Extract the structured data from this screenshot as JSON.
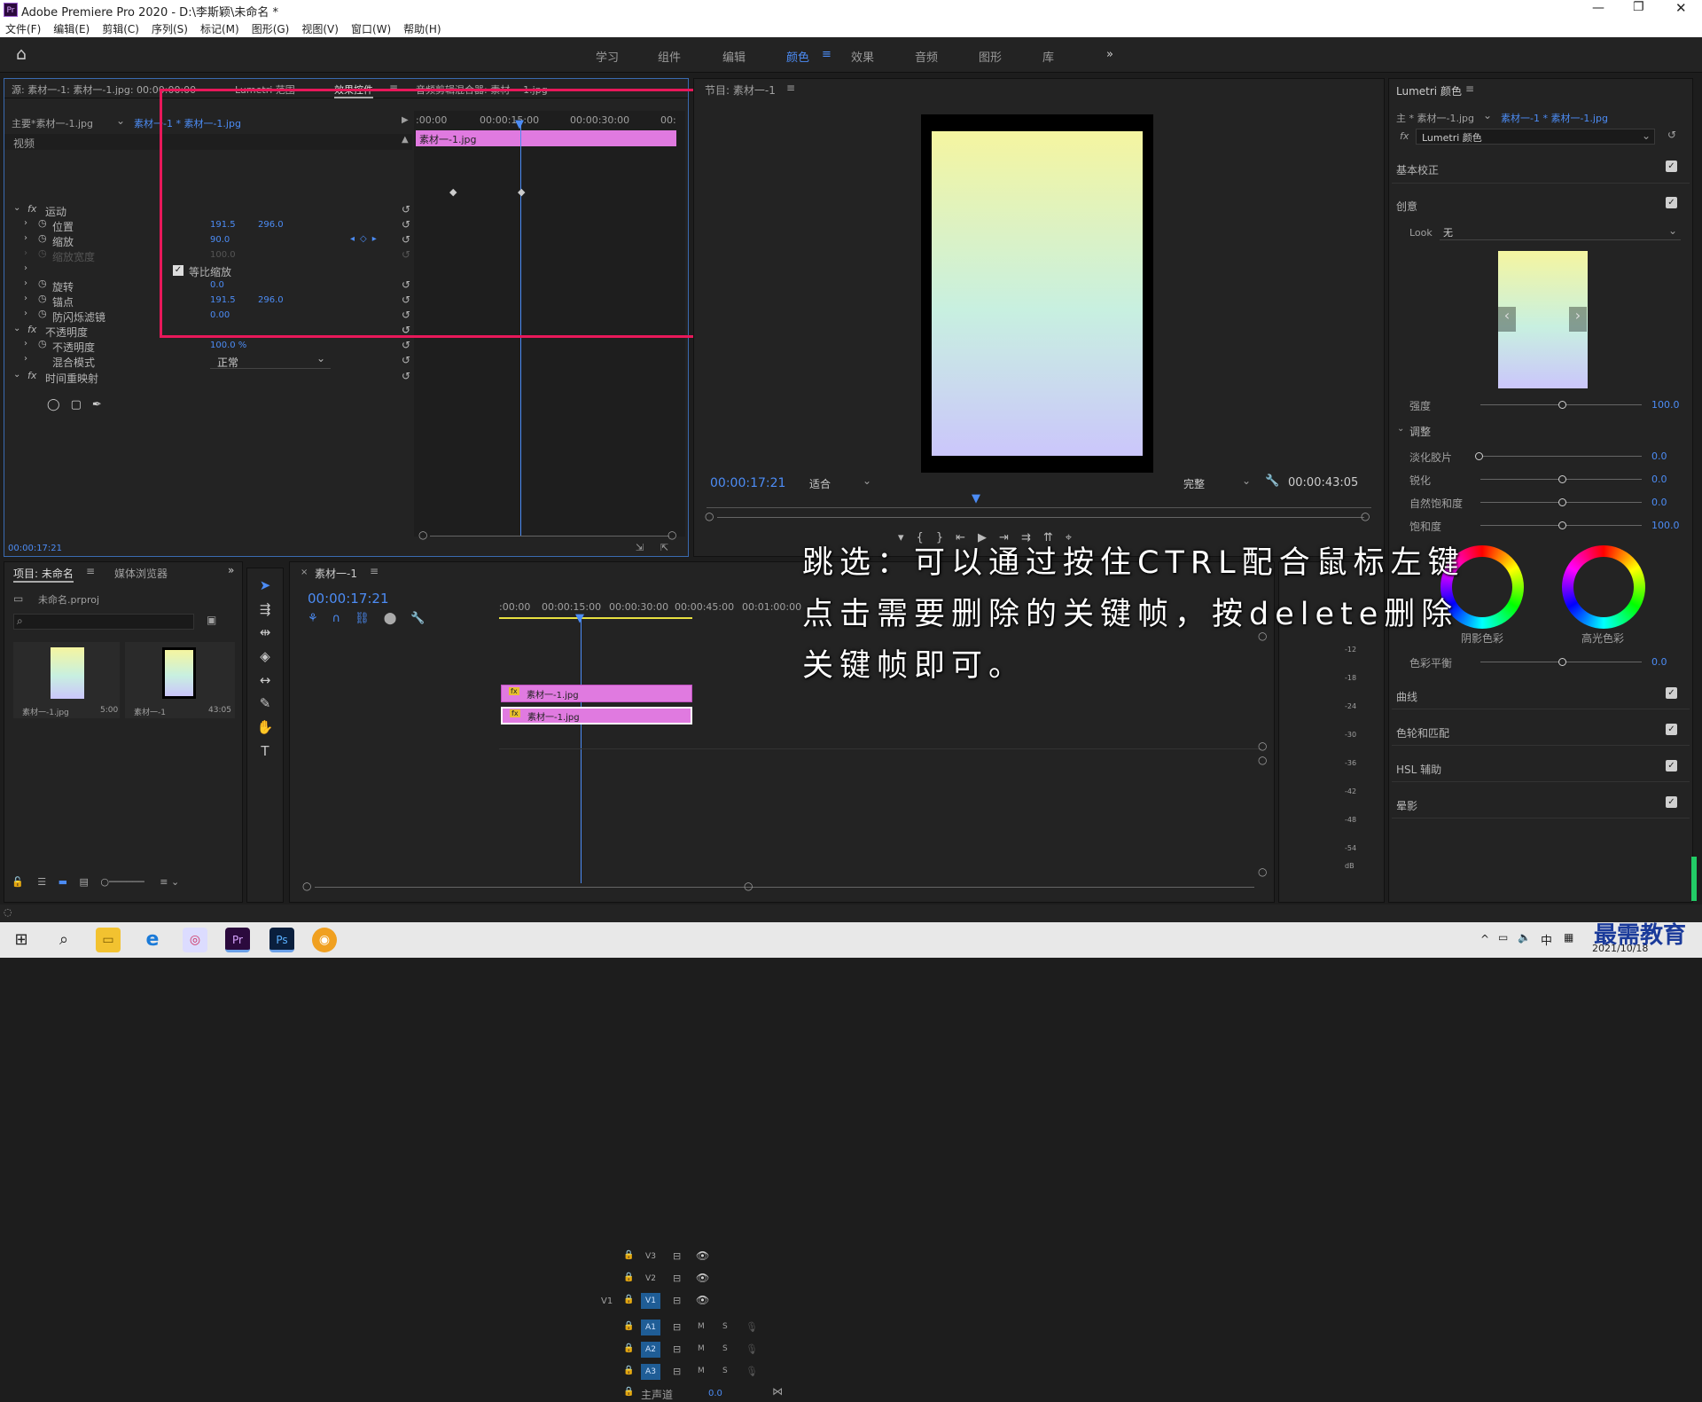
{
  "window": {
    "title": "Adobe Premiere Pro 2020 - D:\\李斯颖\\未命名 *",
    "app_icon": "Pr"
  },
  "menu": [
    "文件(F)",
    "编辑(E)",
    "剪辑(C)",
    "序列(S)",
    "标记(M)",
    "图形(G)",
    "视图(V)",
    "窗口(W)",
    "帮助(H)"
  ],
  "workspaces": [
    "学习",
    "组件",
    "编辑",
    "颜色",
    "效果",
    "音频",
    "图形",
    "库"
  ],
  "active_workspace": "颜色",
  "source_panel": {
    "tabs": [
      "源: 素材一-1: 素材一-1.jpg: 00:00:00:00",
      "Lumetri 范围",
      "效果控件",
      "音频剪辑混合器: 素材一-1.jpg"
    ],
    "clip_master": "主要*素材一-1.jpg",
    "clip_seq": "素材一-1 * 素材一-1.jpg",
    "ruler": [
      ":00:00",
      "00:00:15:00",
      "00:00:30:00",
      "00:"
    ],
    "clip_bar": "素材一-1.jpg",
    "video_label": "视频",
    "timecode": "00:00:17:21",
    "rows": [
      {
        "label": "运动",
        "fx": true
      },
      {
        "label": "位置",
        "v1": "191.5",
        "v2": "296.0"
      },
      {
        "label": "缩放",
        "v1": "90.0"
      },
      {
        "label": "缩放宽度",
        "v1": "100.0",
        "dim": true
      },
      {
        "label": "等比缩放",
        "checkbox": true
      },
      {
        "label": "旋转",
        "v1": "0.0"
      },
      {
        "label": "锚点",
        "v1": "191.5",
        "v2": "296.0"
      },
      {
        "label": "防闪烁滤镜",
        "v1": "0.00"
      },
      {
        "label": "不透明度",
        "fx": true
      },
      {
        "label": "不透明度",
        "v1": "100.0 %"
      },
      {
        "label": "混合模式",
        "select": "正常"
      },
      {
        "label": "时间重映射",
        "fx": true
      }
    ]
  },
  "program": {
    "title": "节目: 素材一-1",
    "timecode": "00:00:17:21",
    "fit": "适合",
    "quality": "完整",
    "duration": "00:00:43:05"
  },
  "lumetri": {
    "title": "Lumetri 颜色",
    "clip_master": "主 * 素材一-1.jpg",
    "clip_seq": "素材一-1 * 素材一-1.jpg",
    "effect": "Lumetri 颜色",
    "basic": "基本校正",
    "creative": "创意",
    "look_label": "Look",
    "look_value": "无",
    "sliders": [
      {
        "label": "强度",
        "value": "100.0"
      }
    ],
    "adjust_label": "调整",
    "adjust": [
      {
        "label": "淡化胶片",
        "value": "0.0"
      },
      {
        "label": "锐化",
        "value": "0.0"
      },
      {
        "label": "自然饱和度",
        "value": "0.0"
      },
      {
        "label": "饱和度",
        "value": "100.0"
      }
    ],
    "wheels": [
      "阴影色彩",
      "高光色彩"
    ],
    "balance": {
      "label": "色彩平衡",
      "value": "0.0"
    },
    "sections": [
      "曲线",
      "色轮和匹配",
      "HSL 辅助",
      "晕影"
    ]
  },
  "project": {
    "tabs": [
      "项目: 未命名",
      "媒体浏览器"
    ],
    "file": "未命名.prproj",
    "items": [
      {
        "name": "素材一-1.jpg",
        "dur": "5:00"
      },
      {
        "name": "素材一-1",
        "dur": "43:05"
      }
    ]
  },
  "timeline": {
    "tab": "素材一-1",
    "timecode": "00:00:17:21",
    "ruler": [
      ":00:00",
      "00:00:15:00",
      "00:00:30:00",
      "00:00:45:00",
      "00:01:00:00"
    ],
    "tracks_v": [
      "V3",
      "V2",
      "V1"
    ],
    "tracks_a": [
      "A1",
      "A2",
      "A3"
    ],
    "master": "主声道",
    "master_val": "0.0",
    "clips": [
      {
        "track": "V3",
        "name": "素材一-1.jpg"
      },
      {
        "track": "V2",
        "name": "素材一-1.jpg"
      }
    ],
    "meter_labels": [
      "-12",
      "-18",
      "-24",
      "-30",
      "-36",
      "-42",
      "-48",
      "-54",
      "dB"
    ]
  },
  "overlay": {
    "lines": [
      "跳选：可以通过按住CTRL配合鼠标左键",
      "点击需要删除的关键帧，按delete删除",
      "关键帧即可。"
    ]
  },
  "taskbar": {
    "clock": "2021/10/18",
    "ime": "中",
    "watermark": "最需教育"
  },
  "colors": {
    "accent": "#4c8cf5",
    "highlight_box": "#e8185a",
    "clip": "#e07ae0"
  }
}
